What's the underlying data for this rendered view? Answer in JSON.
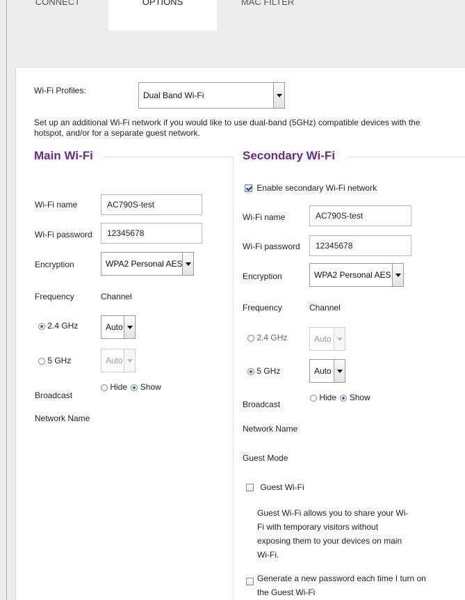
{
  "tabs": [
    {
      "label": "CONNECT",
      "active": false
    },
    {
      "label": "OPTIONS",
      "active": true
    },
    {
      "label": "MAC FILTER",
      "active": false
    }
  ],
  "profiles": {
    "label": "Wi-Fi Profiles:",
    "value": "Dual Band Wi-Fi"
  },
  "intro": "Set up an additional Wi-Fi network if you would like to use dual-band (5GHz) compatible devices with the hotspot, and/or for a separate guest network.",
  "main": {
    "title": "Main Wi-Fi",
    "name_label": "Wi-Fi name",
    "name_value": "AC790S-test",
    "password_label": "Wi-Fi password",
    "password_value": "12345678",
    "encryption_label": "Encryption",
    "encryption_value": "WPA2 Personal AES",
    "frequency_label": "Frequency",
    "channel_label": "Channel",
    "freq_24": "2.4 GHz",
    "freq_24_selected": true,
    "channel_24": "Auto",
    "freq_5": "5 GHz",
    "freq_5_selected": false,
    "channel_5": "Auto",
    "broadcast_label": "Broadcast",
    "network_name_label": "Network Name",
    "hide_label": "Hide",
    "show_label": "Show",
    "broadcast_value": "Show"
  },
  "secondary": {
    "title": "Secondary Wi-Fi",
    "enable_label": "Enable secondary Wi-Fi network",
    "enable_checked": true,
    "name_label": "Wi-Fi name",
    "name_value": "AC790S-test",
    "password_label": "Wi-Fi password",
    "password_value": "12345678",
    "encryption_label": "Encryption",
    "encryption_value": "WPA2 Personal AES",
    "frequency_label": "Frequency",
    "channel_label": "Channel",
    "freq_24": "2.4 GHz",
    "freq_24_selected": false,
    "channel_24": "Auto",
    "freq_5": "5 GHz",
    "freq_5_selected": true,
    "channel_5": "Auto",
    "broadcast_label": "Broadcast",
    "network_name_label": "Network Name",
    "hide_label": "Hide",
    "show_label": "Show",
    "broadcast_value": "Show",
    "guest_mode_label": "Guest Mode",
    "guest_wifi_label": "Guest Wi-Fi",
    "guest_wifi_checked": false,
    "guest_desc": "Guest Wi-Fi allows you to share your Wi-Fi with temporary visitors without exposing them to your devices on main Wi-Fi.",
    "generate_label": "Generate a new password each time I turn on the Guest Wi-Fi",
    "generate_checked": false
  }
}
